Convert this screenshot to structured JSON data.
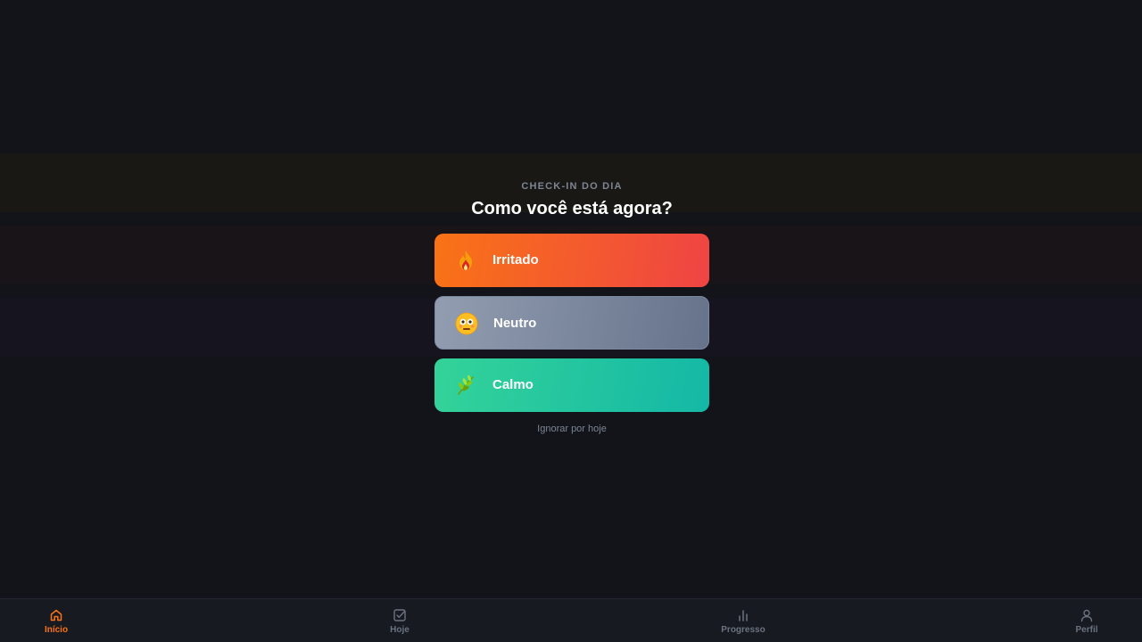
{
  "modal": {
    "eyebrow": "CHECK-IN DO DIA",
    "title": "Como você está agora?",
    "options": [
      {
        "label": "Irritado",
        "icon": "fire-icon",
        "color_from": "#f97316",
        "color_to": "#ef4444"
      },
      {
        "label": "Neutro",
        "icon": "neutral-face-icon",
        "color_from": "#929db1",
        "color_to": "#66738a"
      },
      {
        "label": "Calmo",
        "icon": "herb-icon",
        "color_from": "#34d399",
        "color_to": "#14b8a6"
      }
    ],
    "skip_label": "Ignorar por hoje"
  },
  "nav": {
    "items": [
      {
        "label": "Início",
        "icon": "home-icon",
        "active": true
      },
      {
        "label": "Hoje",
        "icon": "checkbox-icon",
        "active": false
      },
      {
        "label": "Progresso",
        "icon": "bar-chart-icon",
        "active": false
      },
      {
        "label": "Perfil",
        "icon": "user-icon",
        "active": false
      }
    ],
    "active_color": "#f97316",
    "inactive_color": "#6b7280"
  },
  "colors": {
    "background": "#121419",
    "navbar": "#171a21"
  }
}
